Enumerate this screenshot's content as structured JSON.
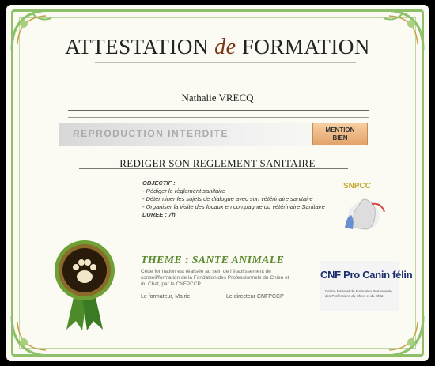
{
  "certificate": {
    "title_part1": "ATTESTATION",
    "title_de": "de",
    "title_part2": "FORMATION",
    "name": "Nathalie VRECQ",
    "watermark": "REPRODUCTION INTERDITE",
    "mention_line1": "MENTION",
    "mention_line2": "BIEN",
    "subject": "REDIGER SON REGLEMENT SANITAIRE",
    "objectives_heading": "OBJECTIF :",
    "objectives": [
      "- Rédiger le règlement sanitaire",
      "- Déterminer les sujets de dialogue avec son vétérinaire sanitaire",
      "- Organiser la visite des locaux en compagnie du vétérinaire Sanitaire"
    ],
    "duration_label": "DUREE : 7h",
    "theme": "THEME : SANTE ANIMALE",
    "description": "Cette formation est réalisée au sein de l'établissement de conseil/formation de la Fondation des Professionnels du Chien et du Chat, par le CNFPCCP",
    "sign_left": "Le formateur, Mairie",
    "sign_right": "Le directeur CNFPCCP",
    "logo_cnf_title": "CNF Pro Canin félin",
    "logo_cnf_subtitle": "Centre National de Formation Permanente des Professions du Chien et du Chat",
    "logo_snpcc": "SNPCC"
  },
  "colors": {
    "frame_green": "#8ec06a",
    "theme_green": "#5c8a2e",
    "title_de": "#7a3412",
    "mention_bg": "#e3a36a",
    "medal_outer": "#5a8a2a",
    "medal_inner": "#2a1a0a"
  },
  "icons": {
    "medal": "paw-medal-icon",
    "snpcc_logo": "dog-cat-logo-icon"
  }
}
